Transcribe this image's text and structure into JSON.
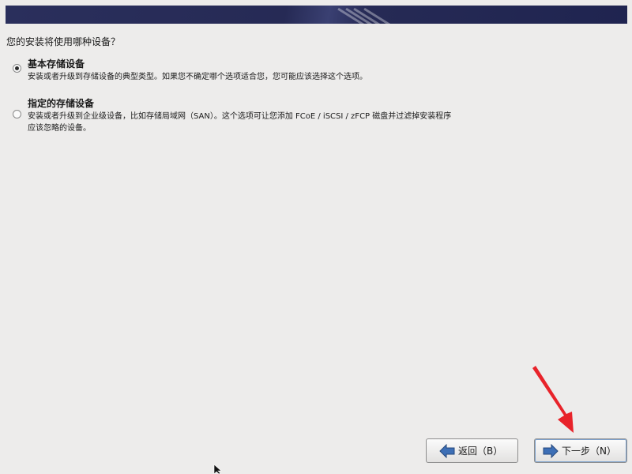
{
  "question": "您的安装将使用哪种设备？",
  "options": [
    {
      "title": "基本存储设备",
      "desc_lines": [
        "安装或者升级到存储设备的典型类型。如果您不确定哪个选项适合您，您可能应该选择这个选项。"
      ],
      "selected": true
    },
    {
      "title": "指定的存储设备",
      "desc_lines": [
        "安装或者升级到企业级设备，比如存储局域网（SAN）。这个选项可让您添加 FCoE / iSCSI / zFCP 磁盘并过滤掉安装程序",
        "应该忽略的设备。"
      ],
      "selected": false
    }
  ],
  "buttons": {
    "back_label": "返回（B）",
    "next_label": "下一步（N）"
  },
  "icons": {
    "back": "left-arrow-icon",
    "next": "right-arrow-icon"
  },
  "colors": {
    "background": "#edeceb",
    "banner": "#262a55",
    "arrow_blue": "#3d6fb6",
    "annotation_red": "#e8232a"
  }
}
